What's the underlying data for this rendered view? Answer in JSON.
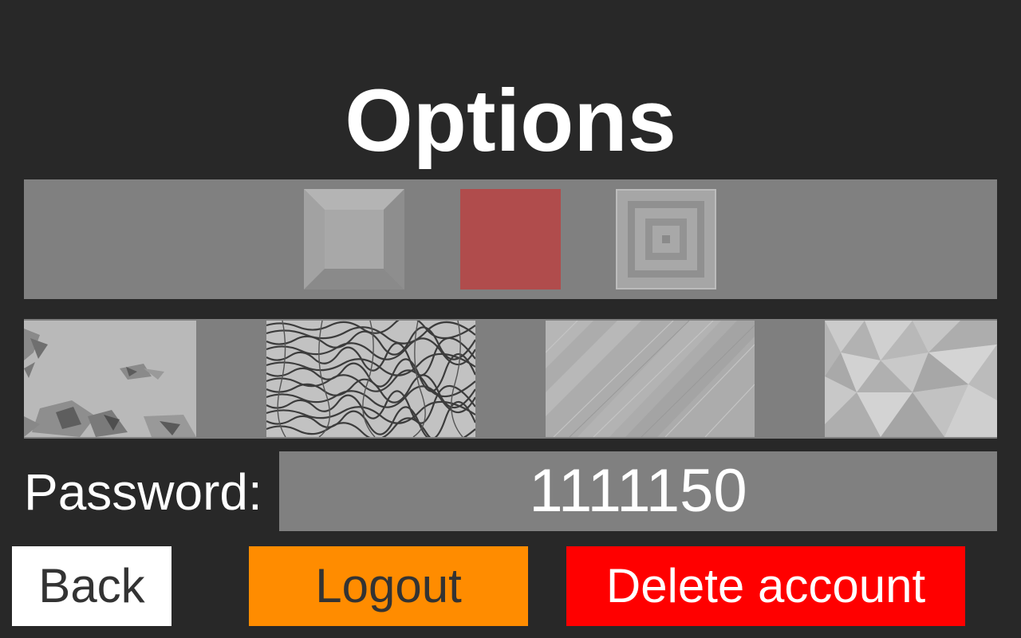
{
  "page": {
    "title": "Options"
  },
  "tile_styles": {
    "options": [
      {
        "name": "bevel-square",
        "color": "#a8a8a8",
        "selected": false
      },
      {
        "name": "red-square",
        "color": "#b04c4c",
        "selected": true
      },
      {
        "name": "concentric-squares",
        "color": "#a8a8a8",
        "selected": false
      }
    ]
  },
  "backgrounds": {
    "options": [
      {
        "name": "shattered-glass"
      },
      {
        "name": "zebra-waves"
      },
      {
        "name": "silk-diagonal"
      },
      {
        "name": "low-poly"
      }
    ]
  },
  "password": {
    "label": "Password:",
    "value": "1111150"
  },
  "buttons": {
    "back": "Back",
    "logout": "Logout",
    "delete": "Delete account"
  },
  "colors": {
    "background": "#282828",
    "panel": "#808080",
    "back_button": "#ffffff",
    "logout_button": "#ff8c00",
    "delete_button": "#ff0000"
  }
}
